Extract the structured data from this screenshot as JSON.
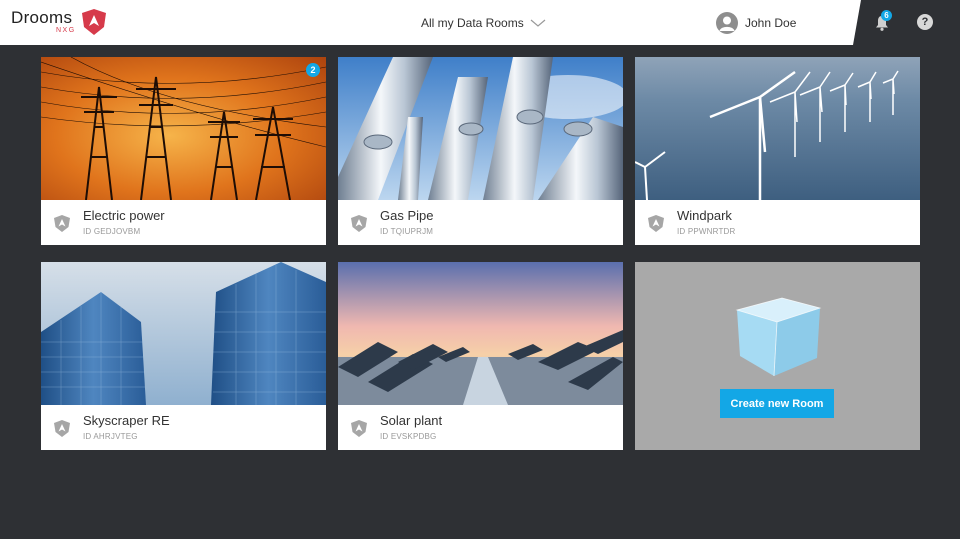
{
  "brand": {
    "name": "Drooms",
    "sub": "NXG",
    "accent": "#d63a4a"
  },
  "header": {
    "selector_label": "All my Data Rooms",
    "user_name": "John Doe",
    "notification_count": "6",
    "help_glyph": "?"
  },
  "rooms": [
    {
      "title": "Electric power",
      "id_label": "ID GEDJOVBM",
      "badge": "2",
      "icon": "power-lines"
    },
    {
      "title": "Gas Pipe",
      "id_label": "ID TQIUPRJM",
      "icon": "pipes"
    },
    {
      "title": "Windpark",
      "id_label": "ID PPWNRTDR",
      "icon": "wind-turbines"
    },
    {
      "title": "Skyscraper RE",
      "id_label": "ID AHRJVTEG",
      "icon": "skyscrapers"
    },
    {
      "title": "Solar plant",
      "id_label": "ID EVSKPDBG",
      "icon": "solar-panels"
    }
  ],
  "create": {
    "label": "Create new Room"
  },
  "colors": {
    "accent": "#13a7e6",
    "background": "#2e3034"
  }
}
